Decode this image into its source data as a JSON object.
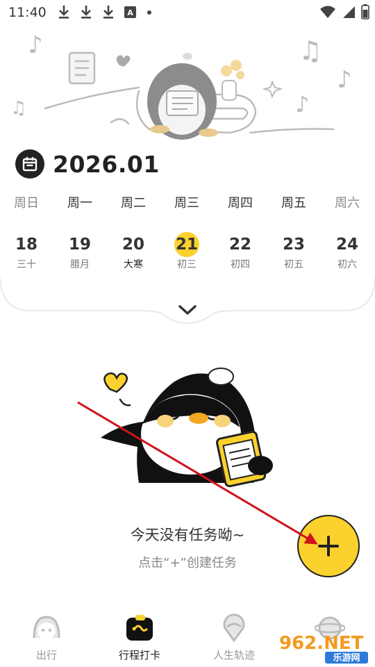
{
  "status_bar": {
    "time": "11:40",
    "a_badge": "A"
  },
  "calendar": {
    "month": "2026.01",
    "weekdays": [
      "周日",
      "周一",
      "周二",
      "周三",
      "周四",
      "周五",
      "周六"
    ],
    "days": [
      {
        "num": "18",
        "lunar": "三十"
      },
      {
        "num": "19",
        "lunar": "腊月"
      },
      {
        "num": "20",
        "lunar": "大寒"
      },
      {
        "num": "21",
        "lunar": "初三"
      },
      {
        "num": "22",
        "lunar": "初四"
      },
      {
        "num": "23",
        "lunar": "初五"
      },
      {
        "num": "24",
        "lunar": "初六"
      }
    ],
    "accent_color": "#FBD12E"
  },
  "empty_state": {
    "title": "今天没有任务呦~",
    "hint": "点击“+”创建任务"
  },
  "bottom_nav": {
    "items": [
      {
        "label": "出行"
      },
      {
        "label": "行程打卡"
      },
      {
        "label": "人生轨迹"
      }
    ]
  },
  "watermark": {
    "brand": "962.NET",
    "sub": "乐游网"
  }
}
